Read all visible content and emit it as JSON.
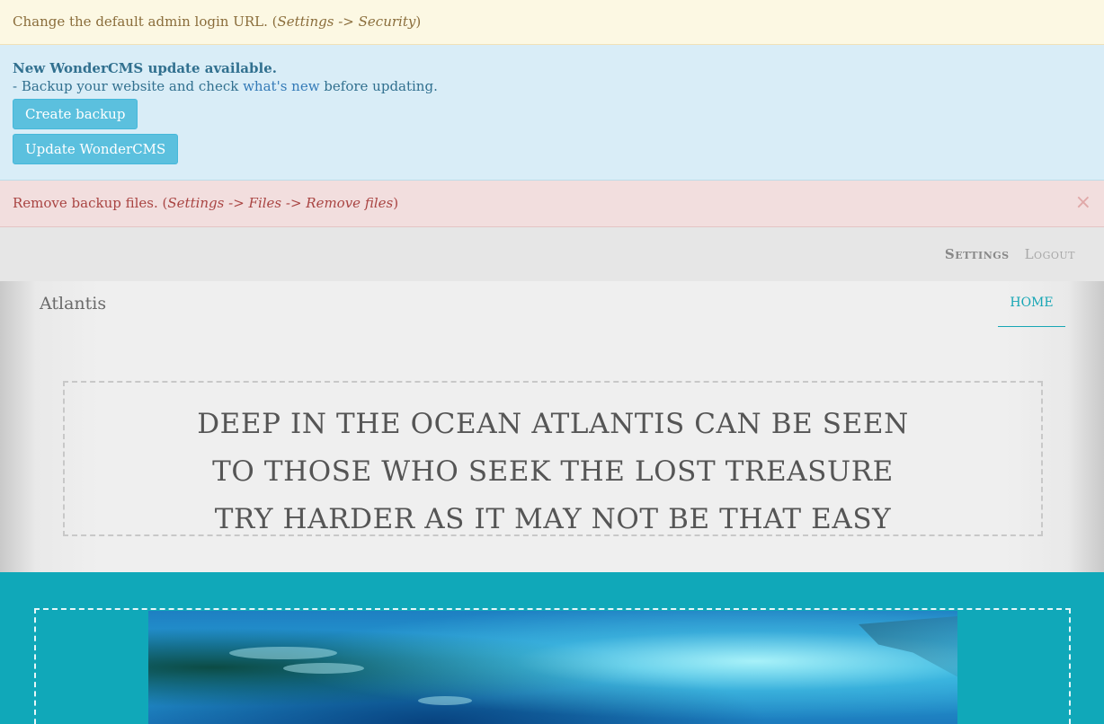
{
  "alerts": {
    "warning": {
      "text": "Change the default admin login URL. (",
      "path": "Settings -> Security",
      "suffix": ")"
    },
    "info": {
      "title": "New WonderCMS update available.",
      "line_prefix": "- Backup your website and check ",
      "link": "what's new",
      "line_suffix": " before updating.",
      "backup_button": "Create backup",
      "update_button": "Update WonderCMS"
    },
    "danger": {
      "text": "Remove backup files. (",
      "path": "Settings -> Files -> Remove files",
      "suffix": ")",
      "close": "×"
    }
  },
  "admin_bar": {
    "settings": "Settings",
    "logout": "Logout"
  },
  "header": {
    "brand": "Atlantis",
    "nav": [
      "HOME"
    ]
  },
  "motto": {
    "lines": [
      "DEEP IN THE OCEAN ATLANTIS CAN BE SEEN",
      "TO THOSE WHO SEEK THE LOST TREASURE",
      "TRY HARDER AS IT MAY NOT BE THAT EASY"
    ]
  },
  "icons": {
    "close": "close-icon"
  },
  "colors": {
    "accent": "#17a6b5",
    "content_background": "#10a8b9",
    "warning_bg": "#fcf8e3",
    "info_bg": "#d9edf7",
    "danger_bg": "#f2dede"
  }
}
